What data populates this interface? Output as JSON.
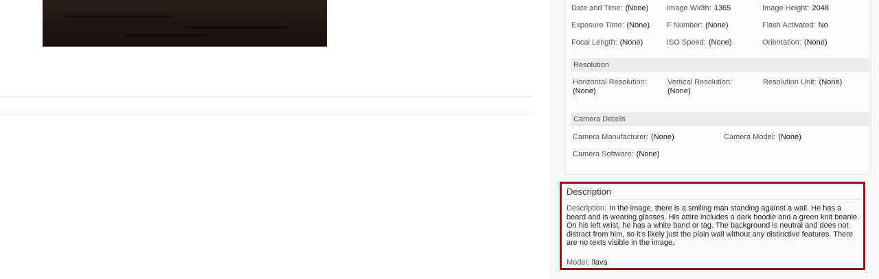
{
  "metadata": {
    "rows": [
      [
        {
          "label": "Date and Time:",
          "value": "(None)"
        },
        {
          "label": "Image Width:",
          "value": "1365"
        },
        {
          "label": "Image Height:",
          "value": "2048"
        }
      ],
      [
        {
          "label": "Exposure Time:",
          "value": "(None)"
        },
        {
          "label": "F Number:",
          "value": "(None)"
        },
        {
          "label": "Flash Activated:",
          "value": "No"
        }
      ],
      [
        {
          "label": "Focal Length:",
          "value": "(None)"
        },
        {
          "label": "ISO Speed:",
          "value": "(None)"
        },
        {
          "label": "Orientation:",
          "value": "(None)"
        }
      ]
    ]
  },
  "resolution": {
    "heading": "Resolution",
    "horizontal": {
      "label": "Horizontal Resolution:",
      "value": "(None)"
    },
    "vertical": {
      "label": "Vertical Resolution:",
      "value": "(None)"
    },
    "unit": {
      "label": "Resolution Unit:",
      "value": "(None)"
    }
  },
  "camera": {
    "heading": "Camera Details",
    "manufacturer": {
      "label": "Camera Manufacturer:",
      "value": "(None)"
    },
    "model": {
      "label": "Camera Model:",
      "value": "(None)"
    },
    "software": {
      "label": "Camera Software:",
      "value": "(None)"
    }
  },
  "description": {
    "heading": "Description",
    "label": "Description:",
    "text": "In the image, there is a smiling man standing against a wall. He has a beard and is wearing glasses. His attire includes a dark hoodie and a green knit beanie. On his left wrist, he has a white band or tag. The background is neutral and does not distract from him, so it's likely just the plain wall without any distinctive features. There are no texts visible in the image.",
    "model_label": "Model:",
    "model_value": "llava"
  },
  "colors": {
    "highlight_border": "#8b1a1a",
    "section_bg": "#ececec"
  }
}
